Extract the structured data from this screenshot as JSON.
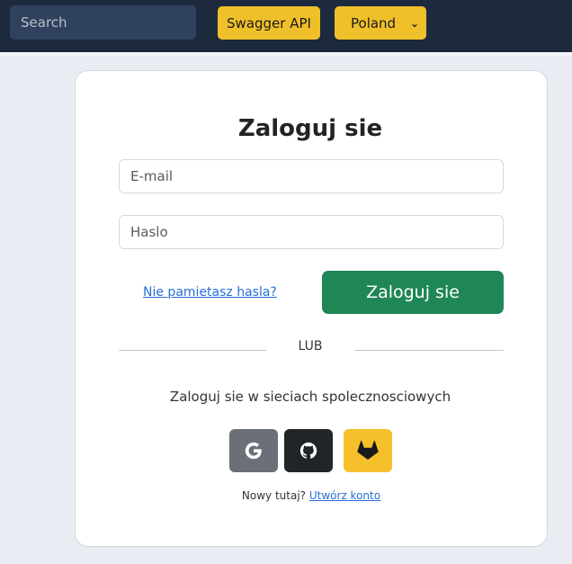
{
  "header": {
    "search_placeholder": "Search",
    "swagger_label": "Swagger API",
    "country_selected": "Poland"
  },
  "login": {
    "title": "Zaloguj sie",
    "email_placeholder": "E-mail",
    "password_placeholder": "Haslo",
    "forgot_link": "Nie pamietasz hasla?",
    "submit_label": "Zaloguj sie",
    "divider_text": "LUB",
    "social_text": "Zaloguj sie w sieciach spolecznosciowych",
    "social": [
      {
        "name": "google-icon",
        "color": "#6b7078"
      },
      {
        "name": "github-icon",
        "color": "#212529"
      },
      {
        "name": "gitlab-icon",
        "color": "#f6c02c"
      }
    ],
    "signup_prompt": "Nowy tutaj?",
    "signup_link": "Utwórz konto"
  },
  "colors": {
    "navbar": "#1d2a3d",
    "accent_yellow": "#f0c02b",
    "primary_green": "#1f8656",
    "link_blue": "#2a6fd6"
  }
}
